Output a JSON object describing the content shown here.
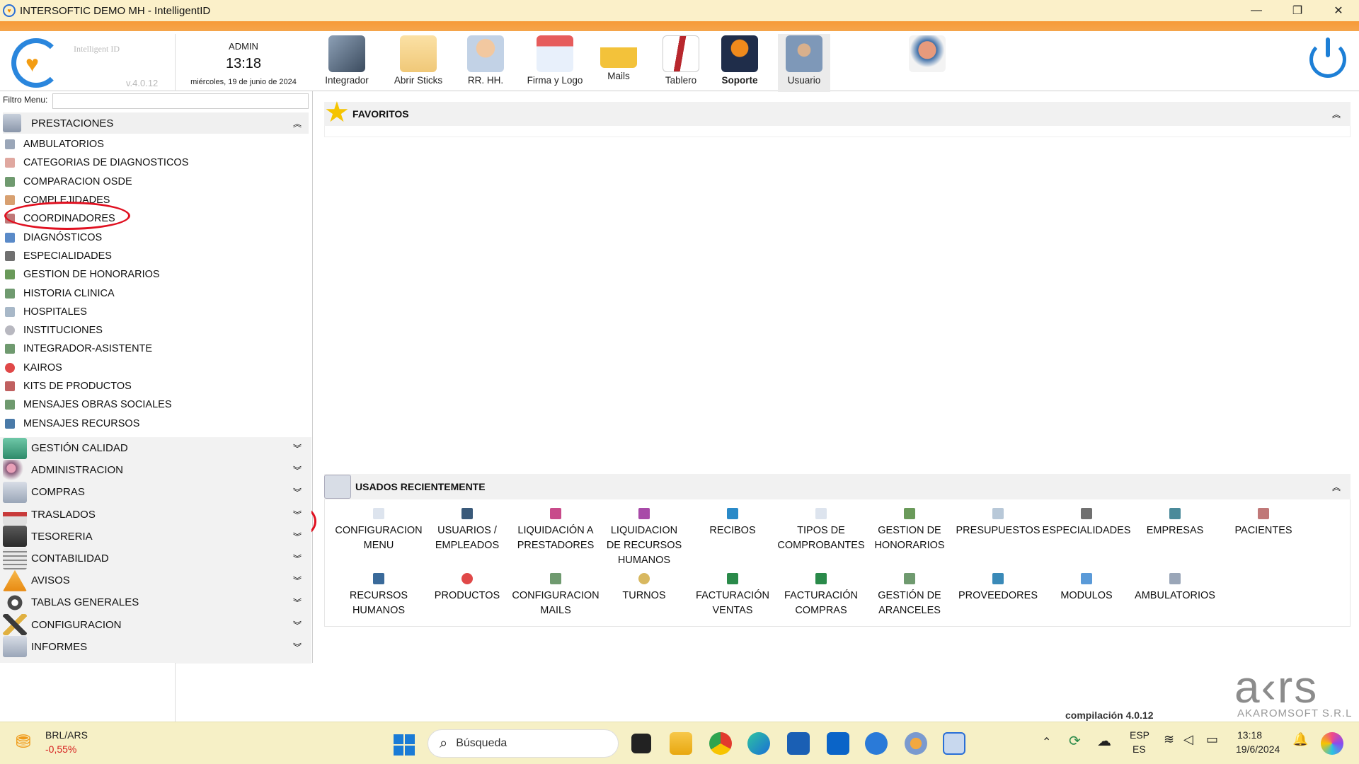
{
  "window": {
    "title": "INTERSOFTIC DEMO MH - IntelligentID",
    "minimize": "—",
    "maximize": "❐",
    "close": "✕"
  },
  "header": {
    "logo_name": "Intelligent ID",
    "version": "v.4.0.12",
    "user": "ADMIN",
    "time": "13:18",
    "date": "miércoles, 19 de junio de 2024"
  },
  "toolbar": [
    {
      "label": "Integrador",
      "icon": "integrator-icon",
      "color": "#3b4b5e"
    },
    {
      "label": "Abrir Sticks",
      "icon": "sticky-note-icon",
      "color": "#f0c878"
    },
    {
      "label": "RR. HH.",
      "icon": "doctor-icon",
      "color": "#c2d2e6"
    },
    {
      "label": "Firma y Logo",
      "icon": "calendar-icon",
      "color": "#e65c5c"
    },
    {
      "label": "Mails",
      "icon": "envelope-icon",
      "color": "#f3c23a"
    },
    {
      "label": "Tablero",
      "icon": "clipboard-icon",
      "color": "#b8272d"
    },
    {
      "label": "Soporte",
      "icon": "support-agent-icon",
      "color": "#f08a1c"
    },
    {
      "label": "Usuario",
      "icon": "user-settings-icon",
      "color": "#7e98b8"
    }
  ],
  "sidebar": {
    "filter_label": "Filtro Menu:",
    "filter_value": "",
    "open_section": "PRESTACIONES",
    "items": [
      "AMBULATORIOS",
      "CATEGORIAS DE DIAGNOSTICOS",
      "COMPARACION OSDE",
      "COMPLEJIDADES",
      "COORDINADORES",
      "DIAGNÓSTICOS",
      "ESPECIALIDADES",
      "GESTION DE HONORARIOS",
      "HISTORIA CLINICA",
      "HOSPITALES",
      "INSTITUCIONES",
      "INTEGRADOR-ASISTENTE",
      "KAIROS",
      "KITS DE PRODUCTOS",
      "MENSAJES OBRAS SOCIALES",
      "MENSAJES RECURSOS"
    ],
    "groups": [
      "GESTIÓN CALIDAD",
      "ADMINISTRACION",
      "COMPRAS",
      "TRASLADOS",
      "TESORERIA",
      "CONTABILIDAD",
      "AVISOS",
      "TABLAS GENERALES",
      "CONFIGURACION",
      "INFORMES"
    ]
  },
  "favoritos": {
    "title": "FAVORITOS"
  },
  "recientes": {
    "title": "USADOS RECIENTEMENTE",
    "tiles": [
      "CONFIGURACION\nMENU",
      "USUARIOS /\nEMPLEADOS",
      "LIQUIDACIÓN A\nPRESTADORES",
      "LIQUIDACION\nDE RECURSOS\nHUMANOS",
      "RECIBOS",
      "TIPOS DE\nCOMPROBANTES",
      "GESTION DE\nHONORARIOS",
      "PRESUPUESTOS",
      "ESPECIALIDADES",
      "EMPRESAS",
      "PACIENTES",
      "RECURSOS\nHUMANOS",
      "PRODUCTOS",
      "CONFIGURACION\nMAILS",
      "TURNOS",
      "FACTURACIÓN\nVENTAS",
      "FACTURACIÓN\nCOMPRAS",
      "GESTIÓN DE\nARANCELES",
      "PROVEEDORES",
      "MODULOS",
      "AMBULATORIOS"
    ]
  },
  "footer": {
    "build": "compilación 4.0.12",
    "brand": "a‹rs",
    "brand_sub": "AKAROMSOFT S.R.L"
  },
  "taskbar": {
    "currency": "BRL/ARS",
    "change": "-0,55%",
    "search_placeholder": "Búsqueda",
    "lang1": "ESP",
    "lang2": "ES",
    "time": "13:18",
    "date": "19/6/2024"
  }
}
